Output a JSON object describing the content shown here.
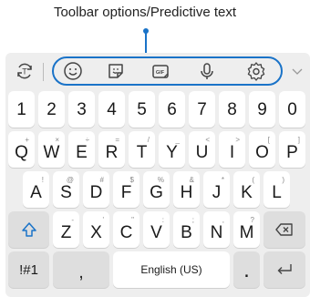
{
  "callout": {
    "label": "Toolbar options/Predictive text"
  },
  "toolbar": {
    "items": [
      {
        "name": "keyboard-toggle-icon"
      },
      {
        "name": "emoji-icon"
      },
      {
        "name": "sticker-icon"
      },
      {
        "name": "gif-icon"
      },
      {
        "name": "voice-input-icon"
      },
      {
        "name": "settings-icon"
      },
      {
        "name": "expand-chevron-icon"
      }
    ],
    "gif_text": "GIF",
    "accent_color": "#1a73c8"
  },
  "rows": {
    "numbers": [
      "1",
      "2",
      "3",
      "4",
      "5",
      "6",
      "7",
      "8",
      "9",
      "0"
    ],
    "row1": [
      {
        "main": "Q",
        "sub": "+"
      },
      {
        "main": "W",
        "sub": "×"
      },
      {
        "main": "E",
        "sub": "÷"
      },
      {
        "main": "R",
        "sub": "="
      },
      {
        "main": "T",
        "sub": "/"
      },
      {
        "main": "Y",
        "sub": "_"
      },
      {
        "main": "U",
        "sub": "<"
      },
      {
        "main": "I",
        "sub": ">"
      },
      {
        "main": "O",
        "sub": "["
      },
      {
        "main": "P",
        "sub": "]"
      }
    ],
    "row2": [
      {
        "main": "A",
        "sub": "!"
      },
      {
        "main": "S",
        "sub": "@"
      },
      {
        "main": "D",
        "sub": "#"
      },
      {
        "main": "F",
        "sub": "$"
      },
      {
        "main": "G",
        "sub": "%"
      },
      {
        "main": "H",
        "sub": "&"
      },
      {
        "main": "J",
        "sub": "*"
      },
      {
        "main": "K",
        "sub": "("
      },
      {
        "main": "L",
        "sub": ")"
      }
    ],
    "row3": [
      {
        "main": "Z",
        "sub": "-"
      },
      {
        "main": "X",
        "sub": "'"
      },
      {
        "main": "C",
        "sub": "\""
      },
      {
        "main": "V",
        "sub": ":"
      },
      {
        "main": "B",
        "sub": ";"
      },
      {
        "main": "N",
        "sub": ","
      },
      {
        "main": "M",
        "sub": "?"
      }
    ],
    "bottom": {
      "symbols": "!#1",
      "comma": ",",
      "space": "English (US)",
      "period": "."
    }
  }
}
